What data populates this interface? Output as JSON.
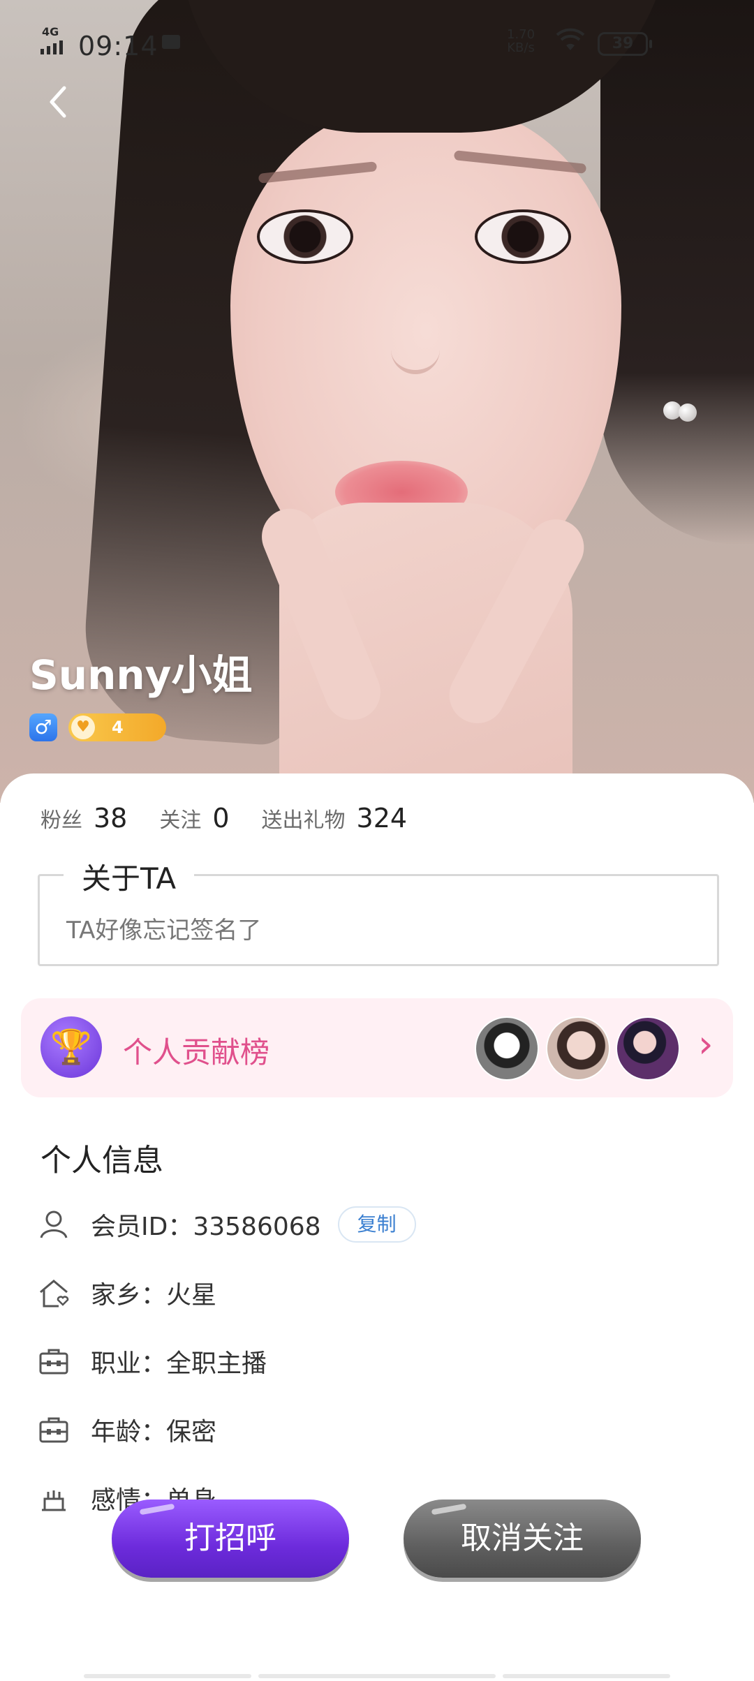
{
  "status_bar": {
    "network": "4G",
    "time": "09:14",
    "speed_value": "1.70",
    "speed_unit": "KB/s",
    "battery": "39"
  },
  "profile": {
    "name": "Sunny小姐",
    "level": "4",
    "gender_symbol": "♂"
  },
  "stats": {
    "fans_label": "粉丝",
    "fans_value": "38",
    "following_label": "关注",
    "following_value": "0",
    "gifts_label": "送出礼物",
    "gifts_value": "324"
  },
  "about": {
    "title": "关于TA",
    "text": "TA好像忘记签名了"
  },
  "contribution": {
    "label": "个人贡献榜",
    "chevron": "›"
  },
  "info": {
    "title": "个人信息",
    "member_id": "会员ID：33586068",
    "copy_label": "复制",
    "hometown": "家乡：火星",
    "job": "职业：全职主播",
    "age": "年龄：保密",
    "relationship": "感情：单身"
  },
  "actions": {
    "greet": "打招呼",
    "unfollow": "取消关注"
  },
  "icons": {
    "back": "chevron-left-icon",
    "trophy": "trophy-icon",
    "user": "user-icon",
    "home": "home-icon",
    "briefcase": "briefcase-icon",
    "cake": "cake-icon"
  }
}
